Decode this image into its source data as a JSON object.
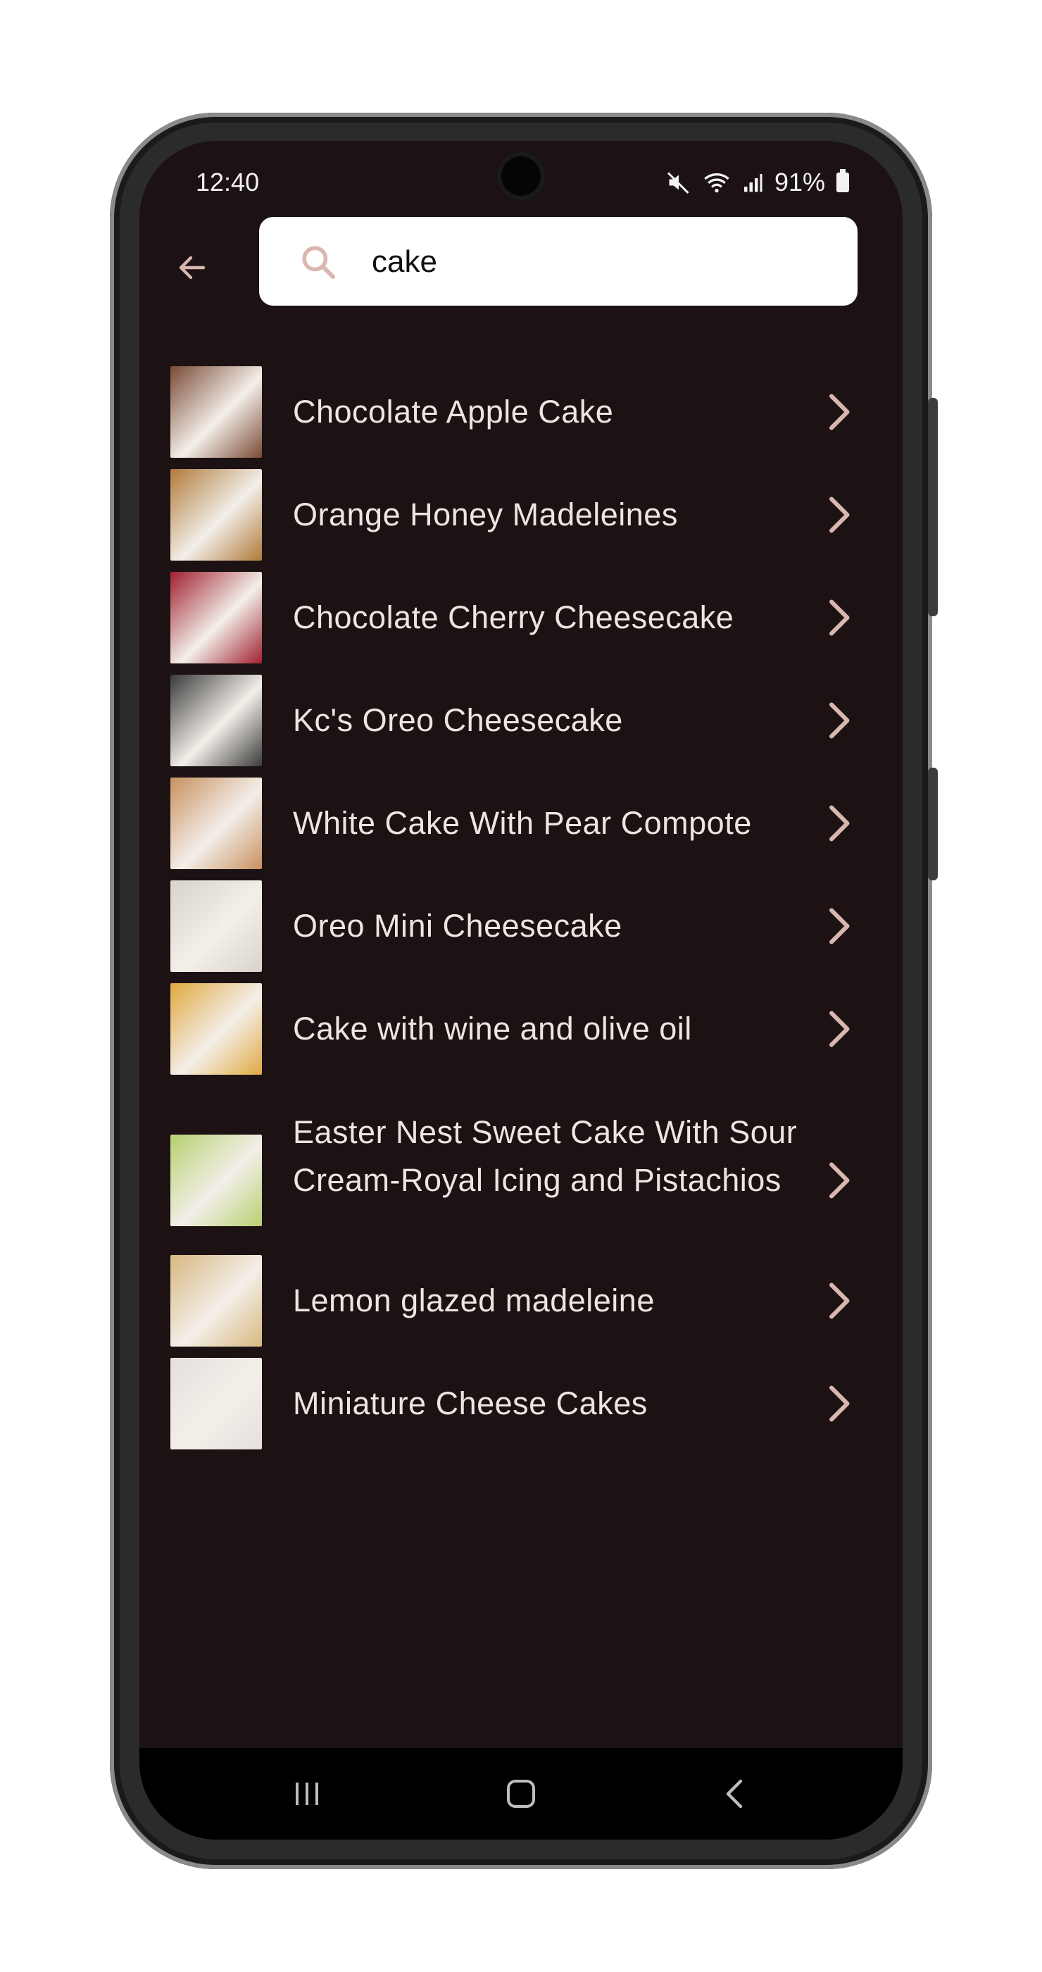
{
  "status": {
    "time": "12:40",
    "battery": "91%"
  },
  "search": {
    "value": "cake",
    "placeholder": ""
  },
  "results": [
    {
      "title": "Chocolate Apple Cake",
      "thumb_icon": "chocolate-apple-cake-thumbnail",
      "thumb_color": "#7a4a35"
    },
    {
      "title": "Orange Honey Madeleines",
      "thumb_icon": "orange-honey-madeleines-thumbnail",
      "thumb_color": "#b07a3a"
    },
    {
      "title": "Chocolate Cherry Cheesecake",
      "thumb_icon": "chocolate-cherry-cheesecake-thumbnail",
      "thumb_color": "#a02030"
    },
    {
      "title": "Kc's Oreo Cheesecake",
      "thumb_icon": "oreo-cheesecake-thumbnail",
      "thumb_color": "#3a3a3a"
    },
    {
      "title": "White Cake With Pear Compote",
      "thumb_icon": "white-cake-pear-compote-thumbnail",
      "thumb_color": "#c89060"
    },
    {
      "title": "Oreo Mini Cheesecake",
      "thumb_icon": "oreo-mini-cheesecake-thumbnail",
      "thumb_color": "#d8d4cc"
    },
    {
      "title": "Cake with wine and olive oil",
      "thumb_icon": "wine-olive-oil-cake-thumbnail",
      "thumb_color": "#e0a840"
    },
    {
      "title": "Easter Nest Sweet Cake With Sour Cream-Royal Icing and Pistachios",
      "thumb_icon": "easter-nest-cake-thumbnail",
      "thumb_color": "#b6d070"
    },
    {
      "title": "Lemon glazed madeleine",
      "thumb_icon": "lemon-glazed-madeleine-thumbnail",
      "thumb_color": "#d8b880"
    },
    {
      "title": "Miniature Cheese Cakes",
      "thumb_icon": "miniature-cheese-cakes-thumbnail",
      "thumb_color": "#e6e0dc"
    }
  ],
  "colors": {
    "background": "#1c1213",
    "text": "#f0e3e3",
    "accent": "#d9b7b0"
  }
}
